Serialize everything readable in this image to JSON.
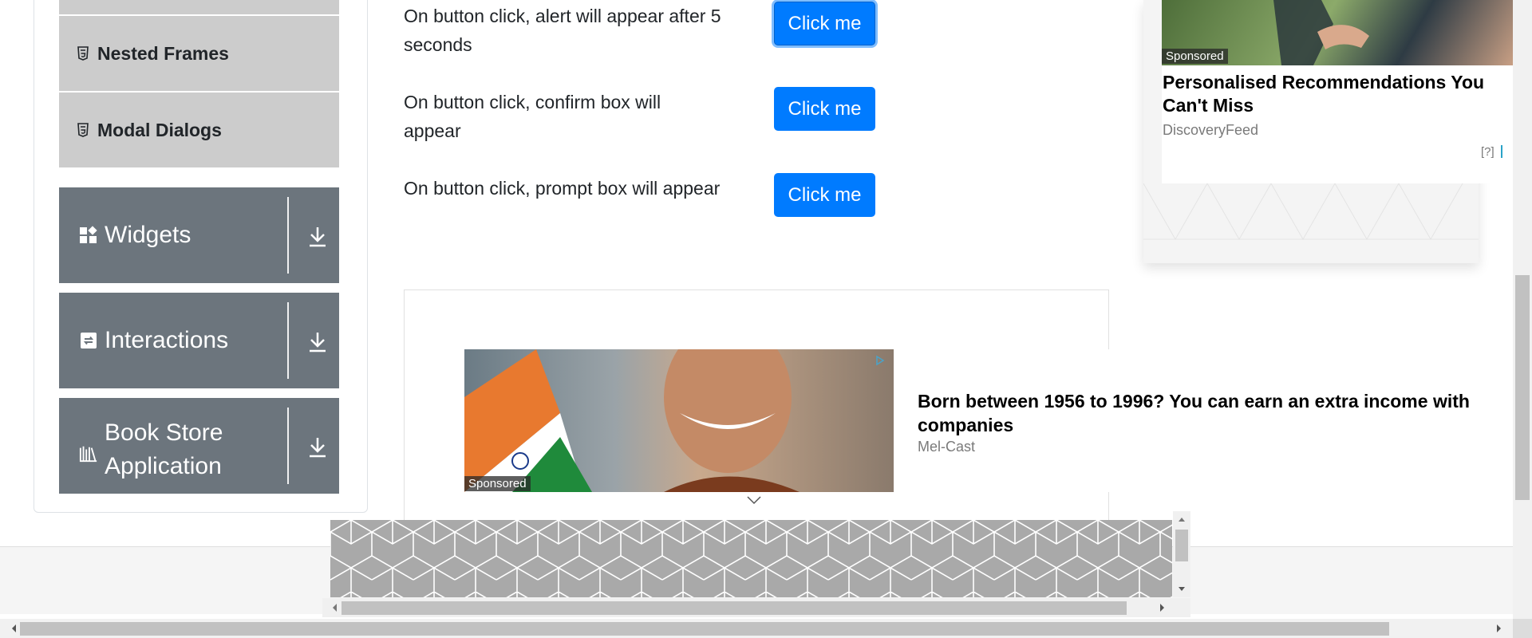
{
  "sidebar": {
    "sub_items": [
      {
        "label": "Nested Frames",
        "icon": "html5-icon"
      },
      {
        "label": "Modal Dialogs",
        "icon": "html5-icon"
      }
    ],
    "groups": [
      {
        "label": "Widgets",
        "icon": "widgets-icon"
      },
      {
        "label": "Interactions",
        "icon": "interactions-icon"
      },
      {
        "label": "Book Store Application",
        "icon": "book-store-icon"
      }
    ]
  },
  "main": {
    "rows": [
      {
        "text": "On button click, alert will appear after 5 seconds",
        "button": "Click me"
      },
      {
        "text": "On button click, confirm box will appear",
        "button": "Click me"
      },
      {
        "text": "On button click, prompt box will appear",
        "button": "Click me"
      }
    ]
  },
  "ads": {
    "center": {
      "sponsored": "Sponsored",
      "headline": "Born between 1956 to 1996? You can earn an extra income with companies",
      "source": "Mel-Cast"
    },
    "right": {
      "sponsored": "Sponsored",
      "headline": "Personalised Recommendations You Can't Miss",
      "source": "DiscoveryFeed",
      "help": "[?]"
    }
  },
  "colors": {
    "primary": "#007bff",
    "group_bg": "#6c757d",
    "sub_item_bg": "#cccccc"
  }
}
